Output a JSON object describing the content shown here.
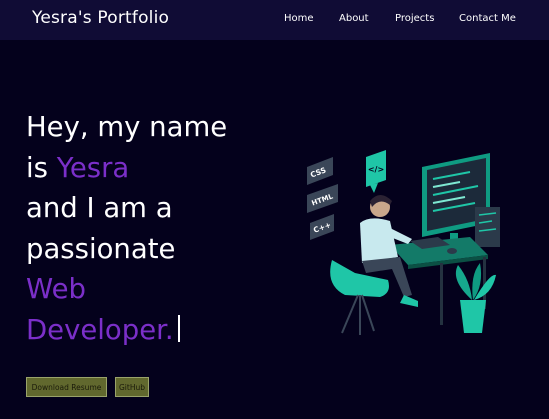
{
  "navbar": {
    "brand": "Yesra's Portfolio",
    "links": [
      "Home",
      "About",
      "Projects",
      "Contact Me"
    ]
  },
  "hero": {
    "line1": "Hey, my name",
    "line2_prefix": "is ",
    "name": "Yesra",
    "line3": "and I am a",
    "line4": "passionate",
    "line5": "Web",
    "line6": "Developer."
  },
  "buttons": {
    "resume": "Download Resume",
    "github": "GitHub"
  },
  "illustration": {
    "tags": [
      "CSS",
      "HTML",
      "C++"
    ],
    "badge": "</>"
  },
  "colors": {
    "background": "#04011c",
    "navbar": "#100c35",
    "accent": "#7b2fc9",
    "teal": "#1fc6a7",
    "button": "#61682e"
  }
}
